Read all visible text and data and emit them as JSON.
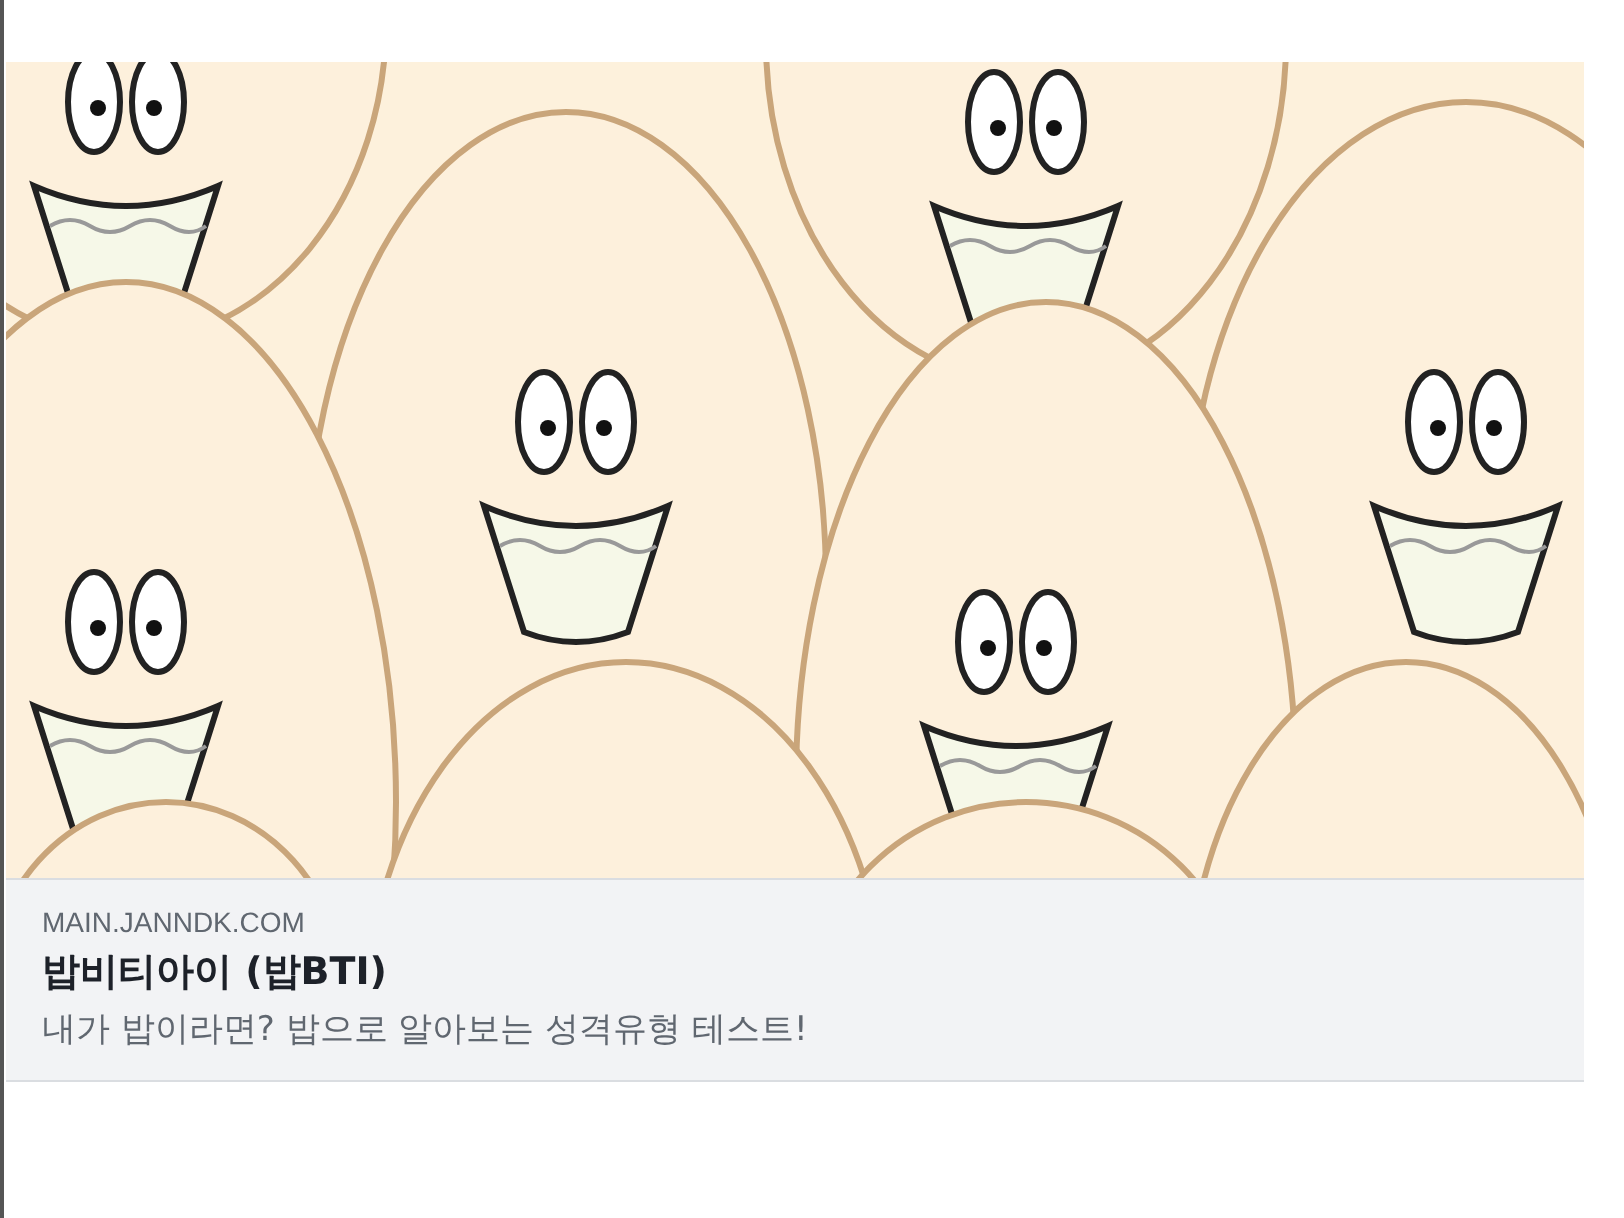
{
  "link_preview": {
    "domain": "MAIN.JANNDK.COM",
    "title": "밥비티아이 (밥BTI)",
    "description": "내가 밥이라면? 밥으로 알아보는 성격유형 테스트!"
  }
}
